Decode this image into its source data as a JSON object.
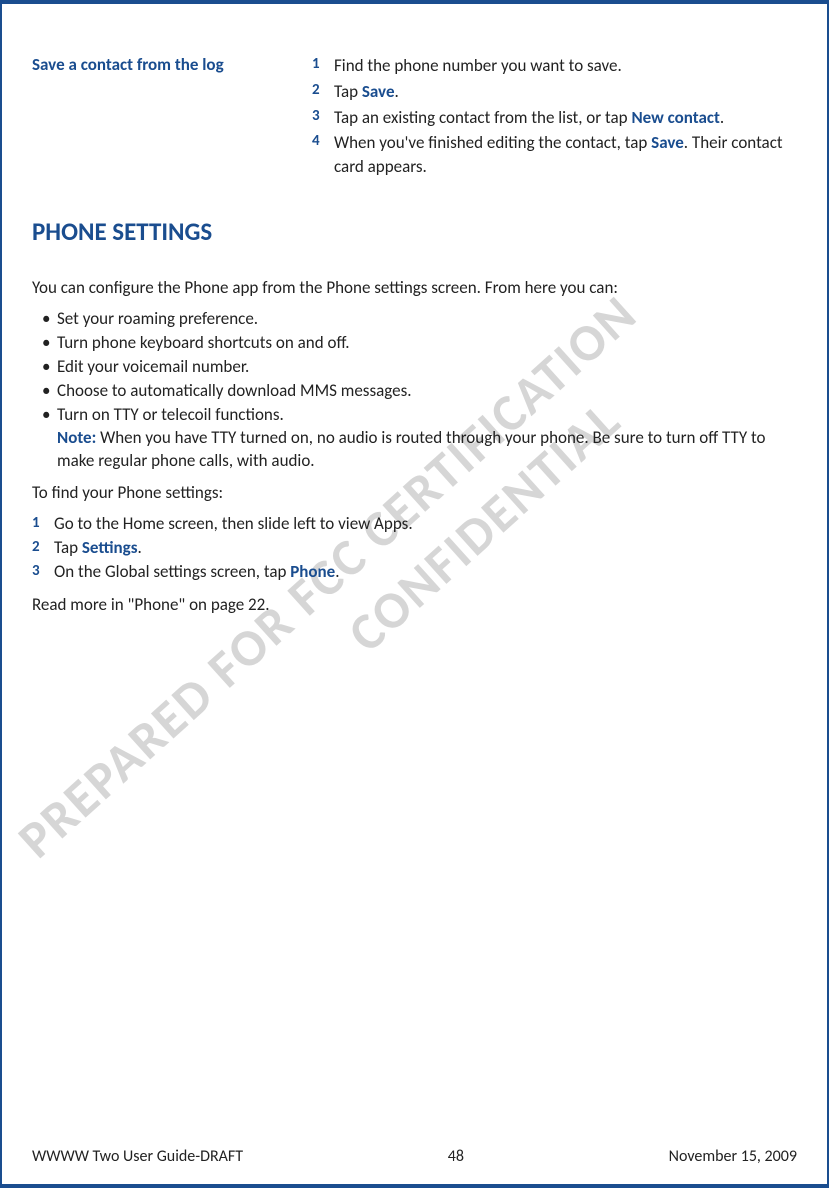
{
  "topSection": {
    "sideHeading": "Save a contact from the log",
    "steps": [
      {
        "num": "1",
        "parts": [
          {
            "t": "Find the phone number you want to save."
          }
        ]
      },
      {
        "num": "2",
        "parts": [
          {
            "t": "Tap "
          },
          {
            "t": "Save",
            "b": true
          },
          {
            "t": "."
          }
        ]
      },
      {
        "num": "3",
        "parts": [
          {
            "t": "Tap an existing contact from the list, or tap "
          },
          {
            "t": "New contact",
            "b": true
          },
          {
            "t": "."
          }
        ]
      },
      {
        "num": "4",
        "parts": [
          {
            "t": "When you've finished editing the contact, tap "
          },
          {
            "t": "Save",
            "b": true
          },
          {
            "t": ". Their contact card appears."
          }
        ]
      }
    ]
  },
  "sectionHeading": "PHONE SETTINGS",
  "introText": "You can configure the Phone app from the Phone settings screen. From here you can:",
  "bullets": [
    {
      "parts": [
        {
          "t": "Set your roaming preference."
        }
      ]
    },
    {
      "parts": [
        {
          "t": "Turn phone keyboard shortcuts on and off."
        }
      ]
    },
    {
      "parts": [
        {
          "t": "Edit your voicemail number."
        }
      ]
    },
    {
      "parts": [
        {
          "t": "Choose to automatically download MMS messages."
        }
      ]
    },
    {
      "parts": [
        {
          "t": "Turn on TTY or telecoil functions."
        }
      ],
      "note": {
        "label": "Note:",
        "text": " When you have TTY turned on, no audio is routed through your phone. Be sure to turn off TTY to make regular phone calls, with audio."
      }
    }
  ],
  "findSettingsText": "To find your Phone settings:",
  "findSteps": [
    {
      "num": "1",
      "parts": [
        {
          "t": "Go to the Home screen, then slide left to view Apps."
        }
      ]
    },
    {
      "num": "2",
      "parts": [
        {
          "t": "Tap "
        },
        {
          "t": "Settings",
          "b": true
        },
        {
          "t": "."
        }
      ]
    },
    {
      "num": "3",
      "parts": [
        {
          "t": "On the Global settings screen, tap "
        },
        {
          "t": "Phone",
          "b": true
        },
        {
          "t": "."
        }
      ]
    }
  ],
  "readMore": "Read more in \"Phone\" on page 22.",
  "footer": {
    "left": "WWWW Two User Guide-DRAFT",
    "center": "48",
    "right": "November 15, 2009"
  },
  "watermark1": "PREPARED FOR FCC CERTIFICATION",
  "watermark2": "CONFIDENTIAL"
}
